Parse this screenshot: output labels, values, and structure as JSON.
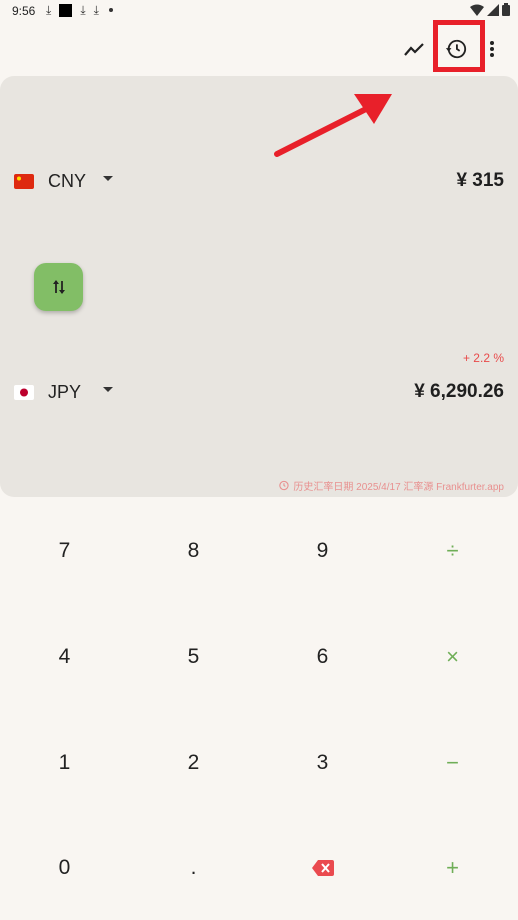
{
  "status_bar": {
    "time": "9:56",
    "download_glyph": "⤓"
  },
  "app_bar": {
    "icons": [
      "chart-line-icon",
      "history-icon",
      "more-vert-icon"
    ]
  },
  "from": {
    "flag": "china-flag-icon",
    "code": "CNY",
    "amount": "¥ 315"
  },
  "to": {
    "flag": "japan-flag-icon",
    "code": "JPY",
    "amount": "¥ 6,290.26"
  },
  "change": "+ 2.2 %",
  "footnote": "历史汇率日期 2025/4/17 汇率源 Frankfurter.app",
  "keypad": {
    "rows": [
      [
        "7",
        "8",
        "9",
        "÷"
      ],
      [
        "4",
        "5",
        "6",
        "×"
      ],
      [
        "1",
        "2",
        "3",
        "−"
      ],
      [
        "0",
        ".",
        "",
        "+"
      ]
    ]
  },
  "colors": {
    "background": "#f9f6f2",
    "card": "#e8e5e0",
    "accent_green": "#82be66",
    "operator_green": "#6fae57",
    "change_red": "#e84a4a",
    "highlight_red": "#e8202a"
  }
}
